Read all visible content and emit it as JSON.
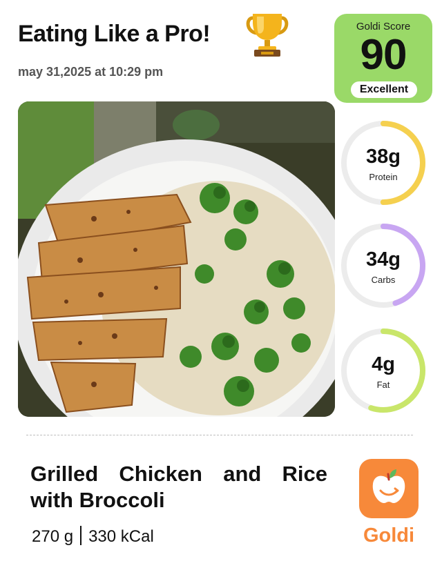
{
  "header": {
    "title": "Eating Like a Pro!",
    "date": "may 31,2025 at 10:29 pm",
    "trophy_icon": "trophy-icon"
  },
  "score": {
    "label": "Goldi Score",
    "value": "90",
    "badge": "Excellent",
    "color": "#9ad968"
  },
  "macros": [
    {
      "value": "38g",
      "label": "Protein",
      "color": "#f5d04f",
      "fraction": 0.5
    },
    {
      "value": "34g",
      "label": "Carbs",
      "color": "#c8a6f2",
      "fraction": 0.45
    },
    {
      "value": "4g",
      "label": "Fat",
      "color": "#c9e66a",
      "fraction": 0.55
    }
  ],
  "meal": {
    "name": "Grilled Chicken and Rice with Broccoli",
    "weight": "270 g",
    "calories": "330 kCal"
  },
  "app": {
    "name": "Goldi",
    "icon": "apple-icon",
    "color": "#f7893a"
  }
}
